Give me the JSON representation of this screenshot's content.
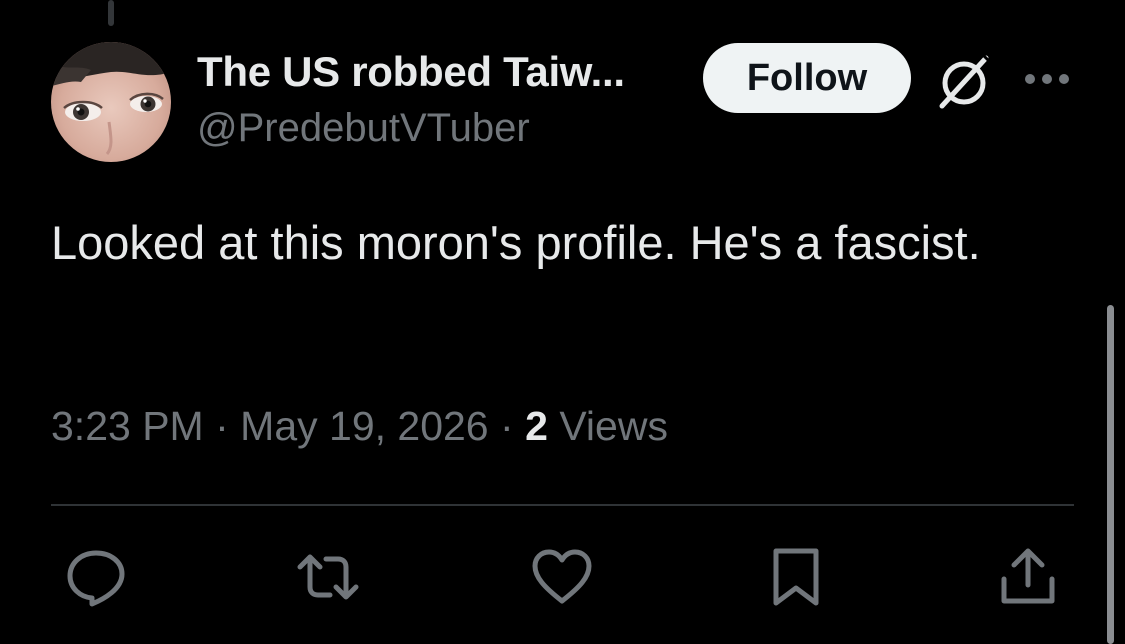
{
  "author": {
    "display_name": "The US robbed Taiw...",
    "handle": "@PredebutVTuber",
    "avatar_icon": "avatar-photo-eyes"
  },
  "header": {
    "follow_label": "Follow",
    "grok_icon": "grok-icon",
    "more_icon": "more-horizontal-icon"
  },
  "tweet": {
    "text": "Looked at this moron's profile. He's a fascist.",
    "time": "3:23 PM",
    "separator": "·",
    "date": "May 19, 2026",
    "views_count": "2",
    "views_label": "Views"
  },
  "actions": {
    "reply_icon": "reply-icon",
    "retweet_icon": "retweet-icon",
    "like_icon": "like-icon",
    "bookmark_icon": "bookmark-icon",
    "share_icon": "share-icon"
  },
  "colors": {
    "background": "#000000",
    "primary_text": "#e7e9ea",
    "secondary_text": "#71767b",
    "divider": "#2f3336",
    "follow_bg": "#eff3f4",
    "follow_text": "#0f1419"
  }
}
